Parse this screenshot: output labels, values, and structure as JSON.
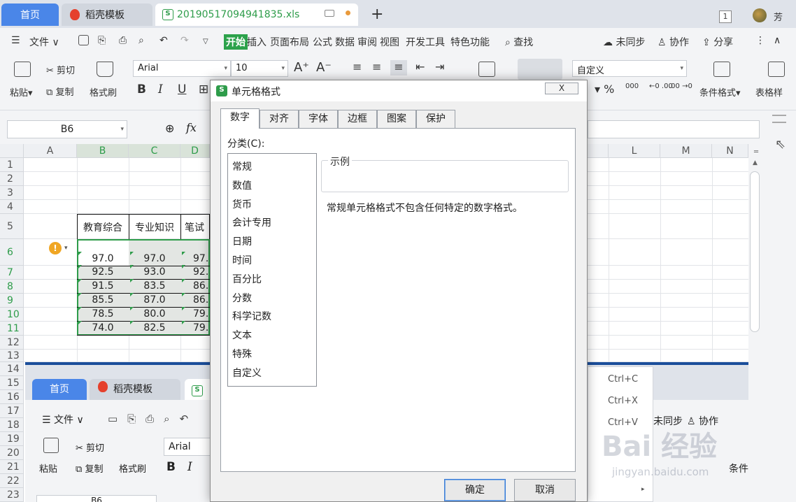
{
  "titlebar": {
    "tab_home": "首页",
    "tab_templates": "稻壳模板",
    "tab_file": "20190517094941835.xls",
    "badge": "1",
    "user_name": "芳"
  },
  "menu": {
    "file": "文件",
    "items": [
      "开始",
      "插入",
      "页面布局",
      "公式",
      "数据",
      "审阅",
      "视图",
      "开发工具",
      "特色功能"
    ],
    "search": "查找",
    "sync": "未同步",
    "collab": "协作",
    "share": "分享"
  },
  "ribbon": {
    "paste": "粘贴",
    "cut": "剪切",
    "copy": "复制",
    "format_painter": "格式刷",
    "font": "Arial",
    "font_size": "10",
    "number_format": "自定义",
    "conditional_format": "条件格式",
    "table_style": "表格样",
    "bold": "B",
    "italic": "I",
    "underline": "U"
  },
  "formula_bar": {
    "name_box": "B6",
    "fx": "fx"
  },
  "sheet": {
    "columns": [
      "A",
      "B",
      "C",
      "D",
      "L",
      "M",
      "N"
    ],
    "rows": [
      "1",
      "2",
      "3",
      "4",
      "5",
      "6",
      "7",
      "8",
      "9",
      "10",
      "11",
      "12",
      "13",
      "14",
      "15",
      "16",
      "17",
      "18",
      "19",
      "20",
      "21",
      "22",
      "23"
    ],
    "headers": [
      "教育综合",
      "专业知识",
      "笔试"
    ],
    "data": [
      [
        "97.0",
        "97.0",
        "97."
      ],
      [
        "92.5",
        "93.0",
        "92."
      ],
      [
        "91.5",
        "83.5",
        "86."
      ],
      [
        "85.5",
        "87.0",
        "86."
      ],
      [
        "78.5",
        "80.0",
        "79."
      ],
      [
        "74.0",
        "82.5",
        "79."
      ]
    ]
  },
  "inner_screenshot": {
    "tab_home": "首页",
    "tab_templates": "稻壳模板",
    "file": "文件",
    "cut": "剪切",
    "copy": "复制",
    "paste": "粘贴",
    "format_painter": "格式刷",
    "font": "Arial",
    "sync": "未同步",
    "collab": "协作",
    "cond": "条件",
    "name_box": "B6"
  },
  "context_menu": {
    "copy_shortcut": "Ctrl+C",
    "cut_shortcut": "Ctrl+X",
    "paste_shortcut": "Ctrl+V"
  },
  "dialog": {
    "title": "单元格格式",
    "close": "X",
    "tabs": [
      "数字",
      "对齐",
      "字体",
      "边框",
      "图案",
      "保护"
    ],
    "category_label": "分类(C):",
    "categories": [
      "常规",
      "数值",
      "货币",
      "会计专用",
      "日期",
      "时间",
      "百分比",
      "分数",
      "科学记数",
      "文本",
      "特殊",
      "自定义"
    ],
    "sample_label": "示例",
    "description": "常规单元格格式不包含任何特定的数字格式。",
    "ok": "确定",
    "cancel": "取消"
  },
  "watermark": {
    "main": "Bai 经验",
    "sub": "jingyan.baidu.com"
  },
  "colors": {
    "accent_blue": "#4a86e8",
    "accent_green": "#2ca24b",
    "inner_border": "#1b4e9b"
  }
}
